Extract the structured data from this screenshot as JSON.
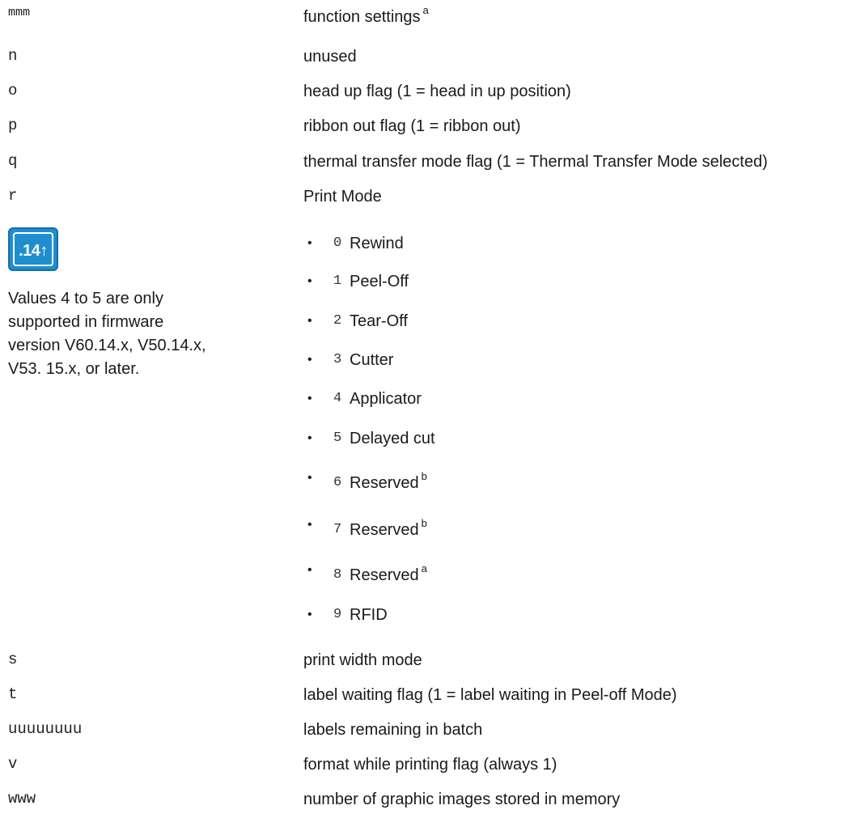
{
  "fields": [
    {
      "code": "mmm",
      "desc": "function settings",
      "sup": "a"
    },
    {
      "code": "n",
      "desc": "unused"
    },
    {
      "code": "o",
      "desc": "head up flag (1 = head in up position)"
    },
    {
      "code": "p",
      "desc": "ribbon out flag (1 = ribbon out)"
    },
    {
      "code": "q",
      "desc": "thermal transfer mode flag (1 = Thermal Transfer Mode selected)"
    },
    {
      "code": "r",
      "desc": "Print Mode"
    },
    {
      "code": "s",
      "desc": "print width mode"
    },
    {
      "code": "t",
      "desc": "label waiting flag (1 = label waiting in Peel-off Mode)"
    },
    {
      "code": "uuuuuuuu",
      "desc": "labels remaining in batch"
    },
    {
      "code": "v",
      "desc": "format while printing flag (always 1)"
    },
    {
      "code": "www",
      "desc": "number of graphic images stored in memory"
    }
  ],
  "badge": {
    "label": ".14",
    "arrow": "↑",
    "color": "#1f8ecf"
  },
  "note": "Values 4 to 5 are only supported in firmware version V60.14.x, V50.14.x, V53. 15.x, or later.",
  "print_modes": [
    {
      "bullet": "•",
      "num": "0",
      "label": "Rewind",
      "sup": ""
    },
    {
      "bullet": "•",
      "num": "1",
      "label": "Peel-Off",
      "sup": ""
    },
    {
      "bullet": "•",
      "num": "2",
      "label": "Tear-Off",
      "sup": ""
    },
    {
      "bullet": "•",
      "num": "3",
      "label": "Cutter",
      "sup": ""
    },
    {
      "bullet": "•",
      "num": "4",
      "label": "Applicator",
      "sup": ""
    },
    {
      "bullet": "•",
      "num": "5",
      "label": "Delayed cut",
      "sup": ""
    },
    {
      "bullet": "•",
      "num": "6",
      "label": "Reserved",
      "sup": "b"
    },
    {
      "bullet": "•",
      "num": "7",
      "label": "Reserved",
      "sup": "b"
    },
    {
      "bullet": "•",
      "num": "8",
      "label": "Reserved",
      "sup": "a"
    },
    {
      "bullet": "•",
      "num": "9",
      "label": "RFID",
      "sup": ""
    }
  ]
}
